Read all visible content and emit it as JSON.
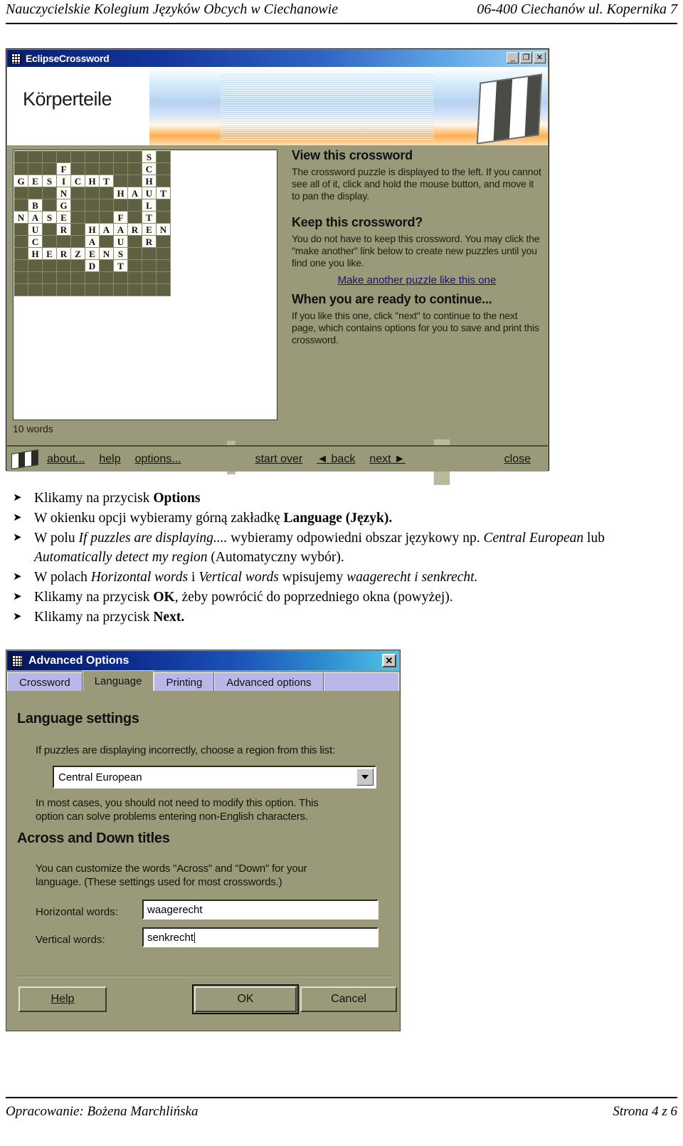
{
  "page_header": {
    "left": "Nauczycielskie Kolegium Języków Obcych w Ciechanowie",
    "right": "06-400 Ciechanów ul. Kopernika 7"
  },
  "page_footer": {
    "left": "Opracowanie: Bożena Marchlińska",
    "right": "Strona 4 z 6"
  },
  "eclipse_window": {
    "title": "EclipseCrossword",
    "titlebar_buttons": {
      "minimize": "_",
      "maximize": "❐",
      "close": "✕"
    },
    "banner_title": "Körperteile",
    "word_count": "10 words",
    "help": {
      "h1": "View this crossword",
      "p1": "The crossword puzzle is displayed to the left. If you cannot see all of it, click and hold the mouse button, and move it to pan the display.",
      "h2": "Keep this crossword?",
      "p2": "You do not have to keep this crossword.  You may click the \"make another\" link below to create new puzzles until you find one you like.",
      "link": "Make another puzzle like this one",
      "h3": "When you are ready to continue...",
      "p3": "If you like this one, click \"next\" to continue to the next page, which contains options for you to save and print this crossword."
    },
    "toolbar": {
      "about": "about...",
      "help": "help",
      "options": "options...",
      "start_over": "start over",
      "back": "◄ back",
      "next": "next ►",
      "close": "close"
    },
    "grid": {
      "cols": 11,
      "rows": 12,
      "letters": [
        [
          "",
          "",
          "",
          "",
          "",
          "",
          "",
          "",
          "",
          "S",
          ""
        ],
        [
          "",
          "",
          "",
          "F",
          "",
          "",
          "",
          "",
          "",
          "C",
          ""
        ],
        [
          "G",
          "E",
          "S",
          "I",
          "C",
          "H",
          "T",
          "",
          "",
          "H",
          ""
        ],
        [
          "",
          "",
          "",
          "N",
          "",
          "",
          "",
          "H",
          "A",
          "U",
          "T"
        ],
        [
          "",
          "B",
          "",
          "G",
          "",
          "",
          "",
          "",
          "",
          "L",
          ""
        ],
        [
          "N",
          "A",
          "S",
          "E",
          "",
          "",
          "",
          "F",
          "",
          "T",
          ""
        ],
        [
          "",
          "U",
          "",
          "R",
          "",
          "H",
          "A",
          "A",
          "R",
          "E",
          "N"
        ],
        [
          "",
          "C",
          "",
          "",
          "",
          "A",
          "",
          "U",
          "",
          "R",
          ""
        ],
        [
          "",
          "H",
          "E",
          "R",
          "Z",
          "E",
          "N",
          "S",
          "",
          "",
          ""
        ],
        [
          "",
          "",
          "",
          "",
          "",
          "D",
          "",
          "T",
          "",
          "",
          ""
        ],
        [
          "",
          "",
          "",
          "",
          "",
          "",
          "",
          "",
          "",
          "",
          ""
        ],
        [
          "",
          "",
          "",
          "",
          "",
          "",
          "",
          "",
          "",
          "",
          ""
        ]
      ]
    }
  },
  "instructions": [
    {
      "parts": [
        {
          "t": "Klikamy na przycisk ",
          "s": "n"
        },
        {
          "t": "Options",
          "s": "b"
        }
      ]
    },
    {
      "parts": [
        {
          "t": "W okienku opcji wybieramy górną zakładkę ",
          "s": "n"
        },
        {
          "t": "Language (Język).",
          "s": "b"
        }
      ]
    },
    {
      "parts": [
        {
          "t": "W polu ",
          "s": "n"
        },
        {
          "t": "If puzzles are displaying....",
          "s": "i"
        },
        {
          "t": " wybieramy odpowiedni obszar językowy np. ",
          "s": "n"
        },
        {
          "t": "Central European",
          "s": "i"
        },
        {
          "t": " lub ",
          "s": "n"
        },
        {
          "t": "Automatically detect my region",
          "s": "i"
        },
        {
          "t": " (Automatyczny wybór).",
          "s": "n"
        }
      ]
    },
    {
      "parts": [
        {
          "t": "W polach ",
          "s": "n"
        },
        {
          "t": "Horizontal words",
          "s": "i"
        },
        {
          "t": " i ",
          "s": "n"
        },
        {
          "t": "Vertical words",
          "s": "i"
        },
        {
          "t": " wpisujemy ",
          "s": "n"
        },
        {
          "t": "waagerecht  i senkrecht.",
          "s": "i"
        }
      ]
    },
    {
      "parts": [
        {
          "t": "Klikamy na przycisk ",
          "s": "n"
        },
        {
          "t": "OK",
          "s": "b"
        },
        {
          "t": ", żeby powrócić do poprzedniego okna (powyżej).",
          "s": "n"
        }
      ]
    },
    {
      "parts": [
        {
          "t": "Klikamy na przycisk ",
          "s": "n"
        },
        {
          "t": "Next.",
          "s": "b"
        }
      ]
    }
  ],
  "advanced_options": {
    "title": "Advanced Options",
    "close_label": "✕",
    "tabs": [
      {
        "label": "Crossword",
        "active": false
      },
      {
        "label": "Language",
        "active": true
      },
      {
        "label": "Printing",
        "active": false
      },
      {
        "label": "Advanced options",
        "active": false
      }
    ],
    "section1_title": "Language settings",
    "region_hint": "If puzzles are displaying incorrectly, choose a region from this list:",
    "region_value": "Central European",
    "region_note_line1": "In most cases, you should not need to modify this option.  This",
    "region_note_line2": "option can solve problems entering non-English characters.",
    "section2_title": "Across and Down titles",
    "titles_note_line1": "You can customize the words \"Across\" and \"Down\" for your",
    "titles_note_line2": "language.  (These settings used for most crosswords.)",
    "horizontal_label": "Horizontal words:",
    "horizontal_value": "waagerecht",
    "vertical_label": "Vertical words:",
    "vertical_value": "senkrecht",
    "buttons": {
      "help": "Help",
      "ok": "OK",
      "cancel": "Cancel"
    }
  },
  "colors": {
    "window_face": "#9a9a7a",
    "grid_block": "#5f5f41",
    "grid_letter_bg": "#fdfdf6",
    "title_blue": "#0d2a8e",
    "tab_lavender": "#b9b6e8",
    "link_blue": "#151570"
  }
}
